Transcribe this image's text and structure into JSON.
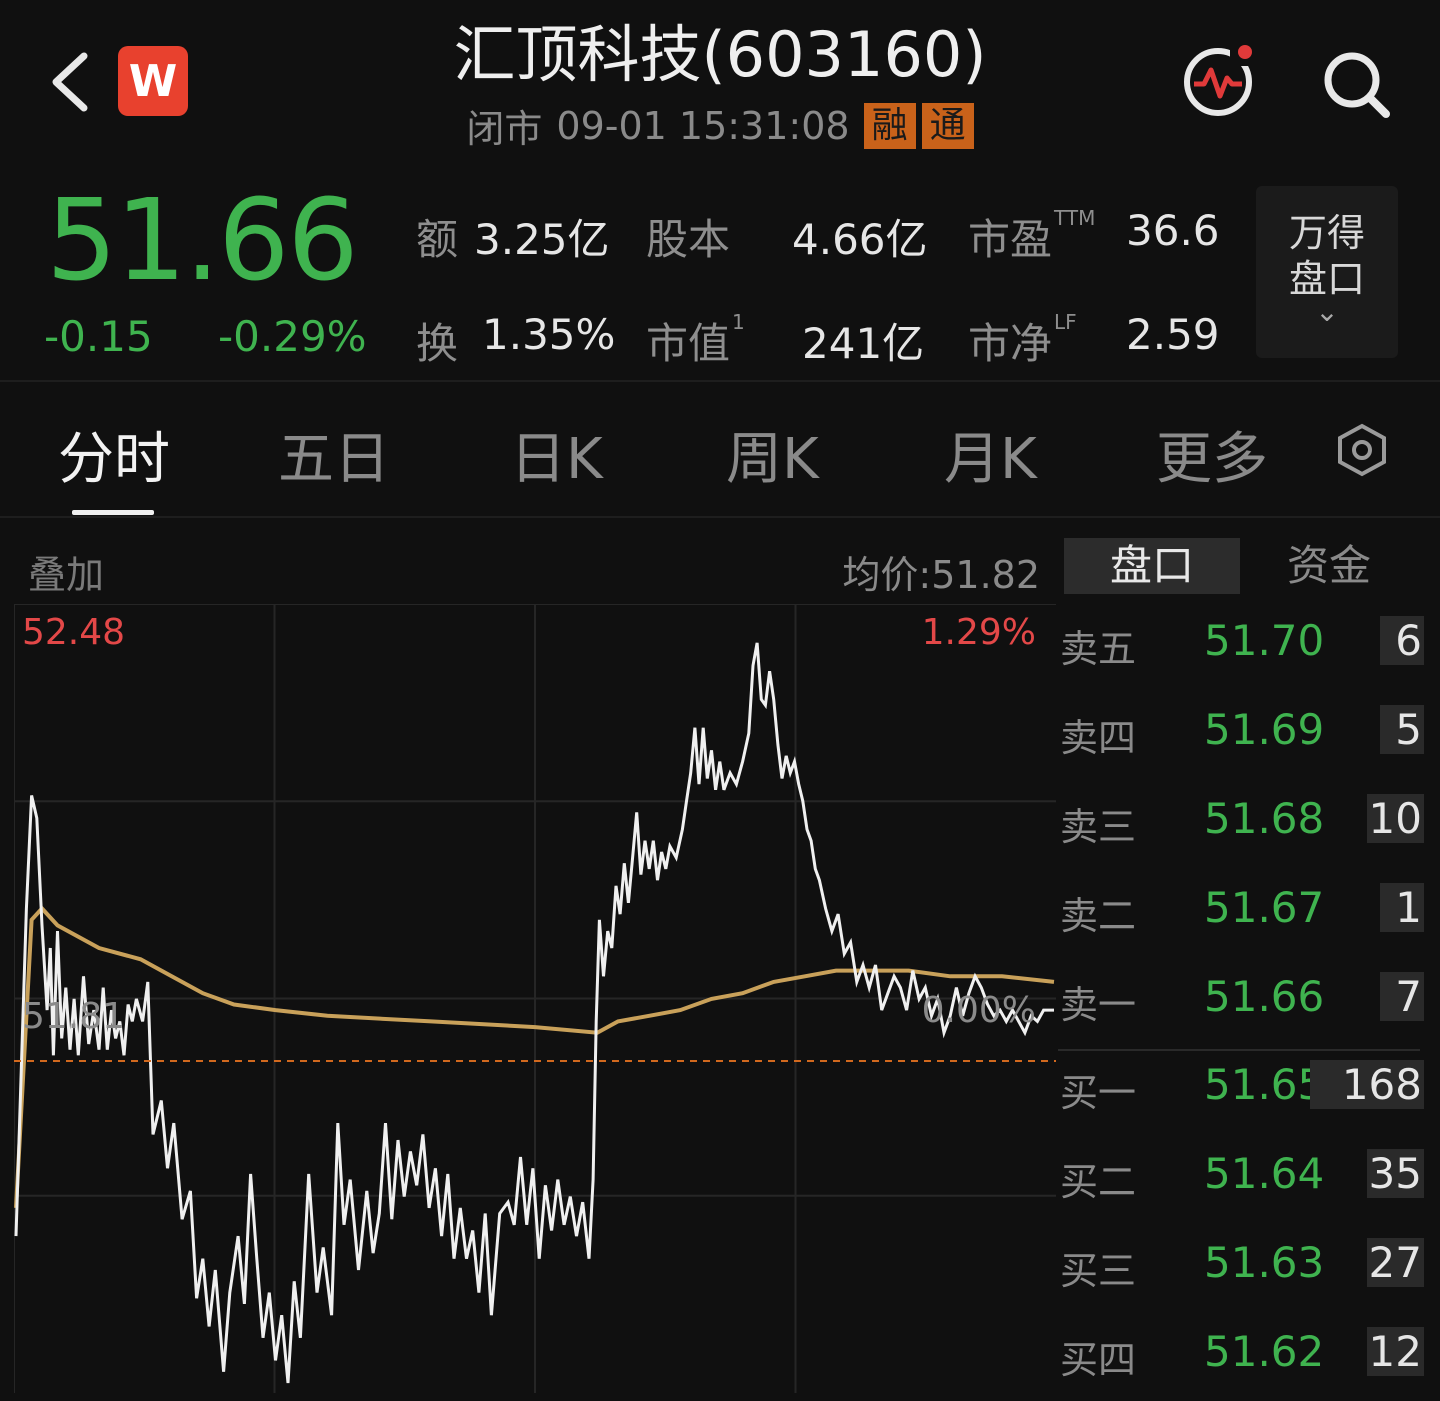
{
  "header": {
    "title": "汇顶科技(603160)",
    "status": "闭市",
    "datetime": "09-01 15:31:08",
    "tag_margin": "融",
    "tag_connect": "通",
    "logo_text": "W",
    "icons": [
      "back-icon",
      "pulse-icon",
      "search-icon"
    ]
  },
  "quote": {
    "price": "51.66",
    "change": "-0.15",
    "change_pct": "-0.29%",
    "stats": [
      {
        "label": "额",
        "value": "3.25亿",
        "sup": ""
      },
      {
        "label": "股本",
        "value": "4.66亿",
        "sup": ""
      },
      {
        "label": "市盈",
        "value": "36.6",
        "sup": "TTM"
      },
      {
        "label": "换",
        "value": "1.35%",
        "sup": ""
      },
      {
        "label": "市值",
        "value": "241亿",
        "sup": "1"
      },
      {
        "label": "市净",
        "value": "2.59",
        "sup": "LF"
      }
    ],
    "wind_pankou_line1": "万得",
    "wind_pankou_line2": "盘口"
  },
  "tabs": [
    {
      "label": "分时",
      "active": true
    },
    {
      "label": "五日",
      "active": false
    },
    {
      "label": "日K",
      "active": false
    },
    {
      "label": "周K",
      "active": false
    },
    {
      "label": "月K",
      "active": false
    },
    {
      "label": "更多",
      "active": false
    }
  ],
  "chart_bar": {
    "overlay_label": "叠加",
    "avg_label": "均价:51.82"
  },
  "panel_tabs": [
    "盘口",
    "资金"
  ],
  "chart_data": {
    "type": "line",
    "title": "",
    "y_max_label": "52.48",
    "y_max_pct_label": "1.29%",
    "y_mid_label": "51.81",
    "y_mid_pct_label": "0.00%",
    "ylim": [
      51.14,
      52.48
    ],
    "prev_close": 51.81,
    "x_range": [
      0,
      100
    ],
    "colors": {
      "price": "#f0f0f0",
      "avg": "#c9a15a",
      "prevclose": "#d2691e"
    },
    "series": [
      {
        "values": [
          [
            0,
            51.4
          ],
          [
            1,
            51.98
          ],
          [
            1.5,
            52.18
          ],
          [
            2,
            52.14
          ],
          [
            2.5,
            51.95
          ],
          [
            3,
            51.8
          ],
          [
            3.3,
            51.91
          ],
          [
            3.6,
            51.72
          ],
          [
            4,
            51.94
          ],
          [
            4.4,
            51.75
          ],
          [
            4.8,
            51.84
          ],
          [
            5.2,
            51.73
          ],
          [
            5.6,
            51.82
          ],
          [
            6,
            51.72
          ],
          [
            6.5,
            51.86
          ],
          [
            7,
            51.74
          ],
          [
            7.5,
            51.8
          ],
          [
            8,
            51.73
          ],
          [
            8.4,
            51.84
          ],
          [
            8.8,
            51.73
          ],
          [
            9.2,
            51.8
          ],
          [
            9.6,
            51.75
          ],
          [
            10,
            51.78
          ],
          [
            10.4,
            51.72
          ],
          [
            10.8,
            51.81
          ],
          [
            11.2,
            51.78
          ],
          [
            11.6,
            51.82
          ],
          [
            12.2,
            51.78
          ],
          [
            12.7,
            51.85
          ],
          [
            13.2,
            51.58
          ],
          [
            14,
            51.64
          ],
          [
            14.6,
            51.52
          ],
          [
            15.2,
            51.6
          ],
          [
            16,
            51.43
          ],
          [
            16.8,
            51.48
          ],
          [
            17.4,
            51.29
          ],
          [
            18,
            51.36
          ],
          [
            18.6,
            51.24
          ],
          [
            19.2,
            51.34
          ],
          [
            20,
            51.16
          ],
          [
            20.6,
            51.3
          ],
          [
            21.4,
            51.4
          ],
          [
            22,
            51.28
          ],
          [
            22.6,
            51.51
          ],
          [
            23.2,
            51.36
          ],
          [
            23.8,
            51.22
          ],
          [
            24.4,
            51.3
          ],
          [
            25,
            51.18
          ],
          [
            25.6,
            51.26
          ],
          [
            26.2,
            51.14
          ],
          [
            26.8,
            51.32
          ],
          [
            27.4,
            51.22
          ],
          [
            28.2,
            51.51
          ],
          [
            29,
            51.3
          ],
          [
            29.6,
            51.38
          ],
          [
            30.4,
            51.26
          ],
          [
            31,
            51.6
          ],
          [
            31.6,
            51.42
          ],
          [
            32.2,
            51.5
          ],
          [
            33,
            51.34
          ],
          [
            33.8,
            51.48
          ],
          [
            34.4,
            51.37
          ],
          [
            35,
            51.44
          ],
          [
            35.6,
            51.6
          ],
          [
            36.2,
            51.43
          ],
          [
            36.8,
            51.57
          ],
          [
            37.4,
            51.47
          ],
          [
            38,
            51.55
          ],
          [
            38.6,
            51.49
          ],
          [
            39.2,
            51.58
          ],
          [
            39.8,
            51.45
          ],
          [
            40.4,
            51.52
          ],
          [
            41,
            51.4
          ],
          [
            41.6,
            51.51
          ],
          [
            42.2,
            51.36
          ],
          [
            42.8,
            51.45
          ],
          [
            43.4,
            51.36
          ],
          [
            44,
            51.41
          ],
          [
            44.6,
            51.3
          ],
          [
            45.2,
            51.44
          ],
          [
            45.8,
            51.26
          ],
          [
            46.6,
            51.44
          ],
          [
            47.4,
            51.46
          ],
          [
            48,
            51.42
          ],
          [
            48.6,
            51.54
          ],
          [
            49.2,
            51.42
          ],
          [
            49.8,
            51.52
          ],
          [
            50.4,
            51.36
          ],
          [
            51,
            51.49
          ],
          [
            51.6,
            51.41
          ],
          [
            52.2,
            51.5
          ],
          [
            52.8,
            51.42
          ],
          [
            53.4,
            51.47
          ],
          [
            54,
            51.4
          ],
          [
            54.6,
            51.46
          ],
          [
            55.2,
            51.36
          ],
          [
            55.6,
            51.5
          ],
          [
            55.9,
            51.78
          ],
          [
            56.2,
            51.96
          ],
          [
            56.6,
            51.86
          ],
          [
            57,
            51.94
          ],
          [
            57.4,
            51.91
          ],
          [
            57.8,
            52.02
          ],
          [
            58.2,
            51.97
          ],
          [
            58.6,
            52.06
          ],
          [
            59,
            51.99
          ],
          [
            59.4,
            52.07
          ],
          [
            59.8,
            52.15
          ],
          [
            60.2,
            52.04
          ],
          [
            60.6,
            52.1
          ],
          [
            61,
            52.05
          ],
          [
            61.4,
            52.1
          ],
          [
            61.8,
            52.03
          ],
          [
            62.2,
            52.08
          ],
          [
            62.6,
            52.05
          ],
          [
            63,
            52.09
          ],
          [
            63.6,
            52.07
          ],
          [
            64.2,
            52.12
          ],
          [
            64.6,
            52.17
          ],
          [
            65,
            52.22
          ],
          [
            65.4,
            52.3
          ],
          [
            65.8,
            52.2
          ],
          [
            66.2,
            52.3
          ],
          [
            66.6,
            52.21
          ],
          [
            67,
            52.26
          ],
          [
            67.4,
            52.19
          ],
          [
            67.8,
            52.24
          ],
          [
            68.2,
            52.19
          ],
          [
            68.8,
            52.22
          ],
          [
            69.4,
            52.2
          ],
          [
            70,
            52.24
          ],
          [
            70.6,
            52.29
          ],
          [
            71,
            52.41
          ],
          [
            71.4,
            52.45
          ],
          [
            71.8,
            52.35
          ],
          [
            72.2,
            52.34
          ],
          [
            72.6,
            52.4
          ],
          [
            73,
            52.35
          ],
          [
            73.4,
            52.27
          ],
          [
            73.8,
            52.21
          ],
          [
            74.2,
            52.25
          ],
          [
            74.6,
            52.22
          ],
          [
            75,
            52.24
          ],
          [
            75.4,
            52.2
          ],
          [
            75.8,
            52.17
          ],
          [
            76.2,
            52.12
          ],
          [
            76.6,
            52.1
          ],
          [
            77,
            52.05
          ],
          [
            77.4,
            52.03
          ],
          [
            78,
            51.98
          ],
          [
            78.6,
            51.94
          ],
          [
            79.2,
            51.97
          ],
          [
            79.8,
            51.9
          ],
          [
            80.4,
            51.92
          ],
          [
            81,
            51.85
          ],
          [
            81.6,
            51.88
          ],
          [
            82.2,
            51.84
          ],
          [
            82.8,
            51.88
          ],
          [
            83.4,
            51.8
          ],
          [
            84,
            51.83
          ],
          [
            84.6,
            51.86
          ],
          [
            85.2,
            51.84
          ],
          [
            85.8,
            51.8
          ],
          [
            86.4,
            51.87
          ],
          [
            87,
            51.82
          ],
          [
            87.6,
            51.84
          ],
          [
            88.2,
            51.79
          ],
          [
            88.8,
            51.82
          ],
          [
            89.4,
            51.76
          ],
          [
            90,
            51.79
          ],
          [
            90.6,
            51.84
          ],
          [
            91.2,
            51.79
          ],
          [
            91.8,
            51.83
          ],
          [
            92.4,
            51.86
          ],
          [
            93,
            51.84
          ],
          [
            93.6,
            51.81
          ],
          [
            94.2,
            51.79
          ],
          [
            94.8,
            51.8
          ],
          [
            95.4,
            51.78
          ],
          [
            96,
            51.8
          ],
          [
            96.6,
            51.78
          ],
          [
            97.2,
            51.76
          ],
          [
            97.8,
            51.79
          ],
          [
            98.4,
            51.78
          ],
          [
            99,
            51.8
          ],
          [
            100,
            51.8
          ]
        ]
      },
      {
        "values": [
          [
            0,
            51.45
          ],
          [
            1.5,
            51.96
          ],
          [
            2.5,
            51.98
          ],
          [
            4,
            51.95
          ],
          [
            8,
            51.91
          ],
          [
            12,
            51.89
          ],
          [
            15,
            51.86
          ],
          [
            18,
            51.83
          ],
          [
            21,
            51.81
          ],
          [
            25,
            51.8
          ],
          [
            30,
            51.79
          ],
          [
            40,
            51.78
          ],
          [
            50,
            51.77
          ],
          [
            56,
            51.76
          ],
          [
            58,
            51.78
          ],
          [
            61,
            51.79
          ],
          [
            64,
            51.8
          ],
          [
            67,
            51.82
          ],
          [
            70,
            51.83
          ],
          [
            73,
            51.85
          ],
          [
            76,
            51.86
          ],
          [
            79,
            51.87
          ],
          [
            82,
            51.87
          ],
          [
            86,
            51.87
          ],
          [
            90,
            51.86
          ],
          [
            95,
            51.86
          ],
          [
            100,
            51.85
          ]
        ]
      }
    ]
  },
  "order_book": {
    "asks": [
      {
        "label": "卖五",
        "price": "51.70",
        "vol": "6"
      },
      {
        "label": "卖四",
        "price": "51.69",
        "vol": "5"
      },
      {
        "label": "卖三",
        "price": "51.68",
        "vol": "10"
      },
      {
        "label": "卖二",
        "price": "51.67",
        "vol": "1"
      },
      {
        "label": "卖一",
        "price": "51.66",
        "vol": "7"
      }
    ],
    "bids": [
      {
        "label": "买一",
        "price": "51.65",
        "vol": "168"
      },
      {
        "label": "买二",
        "price": "51.64",
        "vol": "35"
      },
      {
        "label": "买三",
        "price": "51.63",
        "vol": "27"
      },
      {
        "label": "买四",
        "price": "51.62",
        "vol": "12"
      }
    ]
  }
}
